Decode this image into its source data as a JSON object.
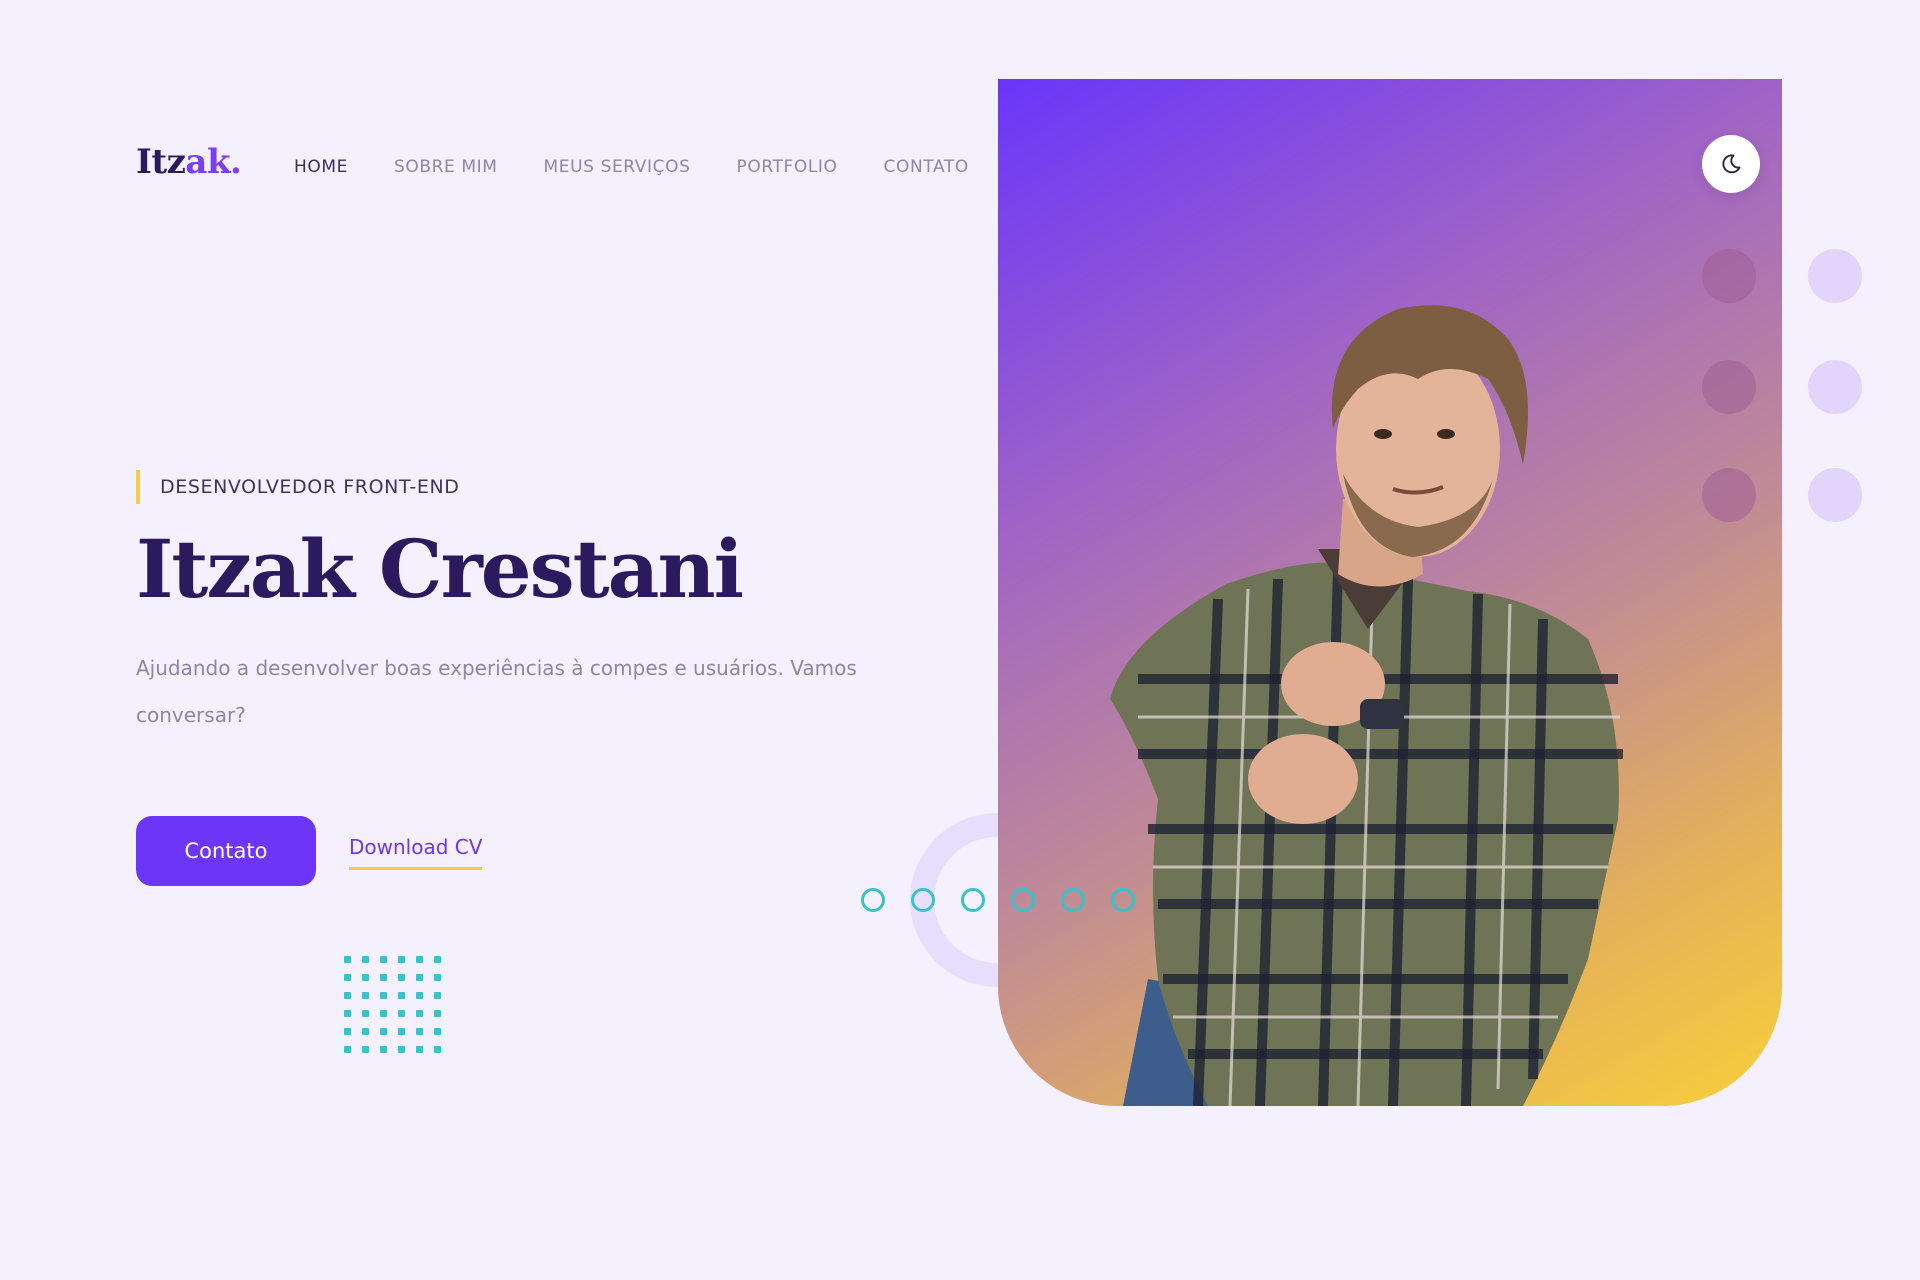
{
  "brand": {
    "logo_main": "Itz",
    "logo_accent": "ak."
  },
  "nav": {
    "items": [
      {
        "label": "HOME",
        "active": true
      },
      {
        "label": "SOBRE MIM",
        "active": false
      },
      {
        "label": "MEUS SERVIÇOS",
        "active": false
      },
      {
        "label": "PORTFOLIO",
        "active": false
      },
      {
        "label": "CONTATO",
        "active": false
      }
    ]
  },
  "hero": {
    "eyebrow": "DESENVOLVEDOR FRONT-END",
    "name": "Itzak Crestani",
    "description": "Ajudando a desenvolver boas experiências à compes e usuários. Vamos conversar?",
    "primary_button": "Contato",
    "secondary_link": "Download CV"
  },
  "theme_toggle": {
    "icon": "moon-icon"
  },
  "colors": {
    "background": "#f4f0fe",
    "primary": "#6c35f8",
    "heading": "#2b1a5e",
    "accent_yellow": "#f7c948",
    "accent_teal": "#36c3c9",
    "gradient_start": "#6a35fb",
    "gradient_end": "#f8cf3a"
  }
}
